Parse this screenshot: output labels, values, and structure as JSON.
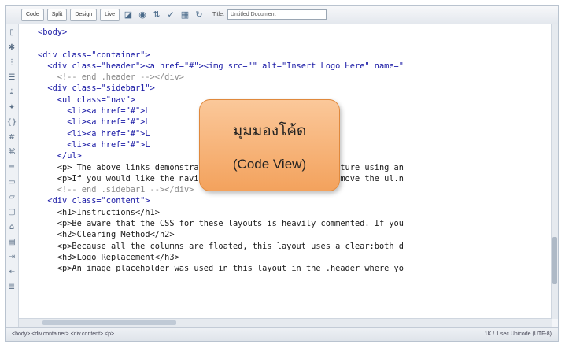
{
  "toolbar": {
    "code_label": "Code",
    "split_label": "Split",
    "design_label": "Design",
    "live_label": "Live",
    "title_label": "Title:",
    "title_value": "Untitled Document"
  },
  "code_lines": [
    "<body>",
    "",
    "<div class=\"container\">",
    "  <div class=\"header\"><a href=\"#\"><img src=\"\" alt=\"Insert Logo Here\" name=\"",
    "    <!-- end .header --></div>",
    "  <div class=\"sidebar1\">",
    "    <ul class=\"nav\">",
    "      <li><a href=\"#\">L",
    "      <li><a href=\"#\">L",
    "      <li><a href=\"#\">L",
    "      <li><a href=\"#\">L",
    "    </ul>",
    "    <p> The above links demonstrate a basic navigational structure using an",
    "    <p>If you would like the navigation along the top, simply move the ul.n",
    "    <!-- end .sidebar1 --></div>",
    "  <div class=\"content\">",
    "    <h1>Instructions</h1>",
    "    <p>Be aware that the CSS for these layouts is heavily commented. If you",
    "    <h2>Clearing Method</h2>",
    "    <p>Because all the columns are floated, this layout uses a clear:both d",
    "    <h3>Logo Replacement</h3>",
    "    <p>An image placeholder was used in this layout in the .header where yo"
  ],
  "callout": {
    "title": "มุมมองโค้ด",
    "subtitle": "(Code View)"
  },
  "statusbar": {
    "breadcrumb": "<body> <div.container> <div.content> <p>",
    "info": "1K / 1 sec  Unicode (UTF-8)"
  },
  "colors": {
    "callout_fill": "#f3a25d",
    "code_tag": "#1a1aa6",
    "comment": "#8a8a8a"
  }
}
